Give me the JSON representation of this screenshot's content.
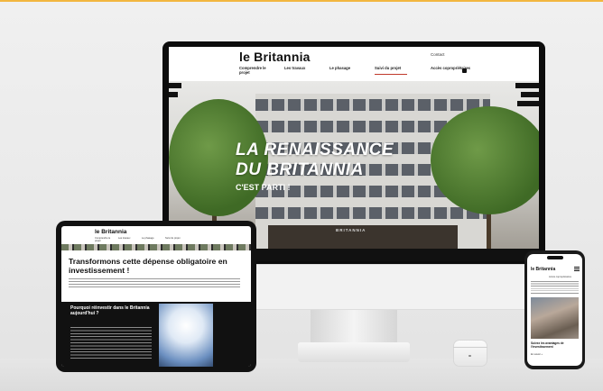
{
  "imac": {
    "site": {
      "logo": "le Britannia",
      "nav": [
        {
          "label": "Comprendre le projet",
          "active": false
        },
        {
          "label": "Les travaux",
          "active": false
        },
        {
          "label": "Le phasage",
          "active": false
        },
        {
          "label": "Suivi du projet",
          "active": true
        }
      ],
      "contact": "Contact",
      "espace": "Accès copropriétaires"
    },
    "hero": {
      "title_line1": "LA RENAISSANCE",
      "title_line2": "DU BRITANNIA",
      "subtitle": "C'EST PARTI !",
      "storefront_sign": "BRITANNIA"
    }
  },
  "ipad": {
    "logo": "le Britannia",
    "nav": [
      "Comprendre le projet",
      "Les travaux",
      "Le phasage",
      "Suivi du projet"
    ],
    "heading": "Transformons cette dépense obligatoire en investissement !",
    "dark_title": "Pourquoi réinvestir dans le Britannia aujourd'hui ?"
  },
  "phone": {
    "logo": "le Britannia",
    "link": "Accès copropriétaires",
    "caption": "Suivez les avantages de l'investissement",
    "button": "En savoir +"
  },
  "colors": {
    "accent": "#f2b640",
    "nav_active": "#c0392b",
    "dark": "#111111"
  }
}
